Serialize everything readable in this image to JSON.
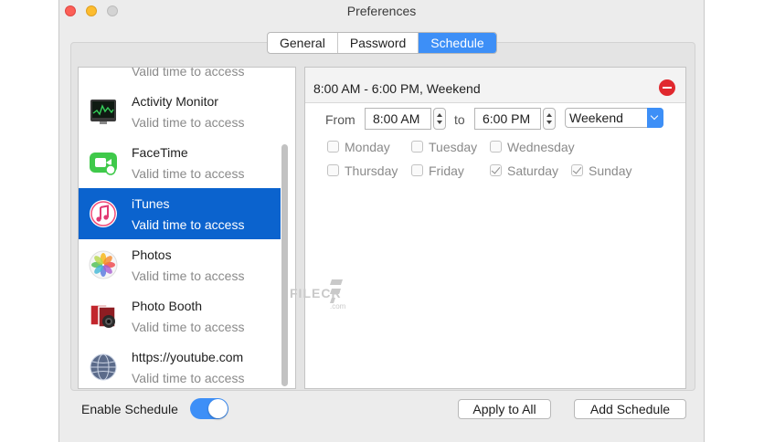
{
  "window": {
    "title": "Preferences"
  },
  "tabs": [
    {
      "label": "General",
      "active": false
    },
    {
      "label": "Password",
      "active": false
    },
    {
      "label": "Schedule",
      "active": true
    }
  ],
  "apps": {
    "partial_top_sub": "Valid time to access",
    "items": [
      {
        "name": "Activity Monitor",
        "subtitle": "Valid time to access",
        "icon": "activity-monitor-icon",
        "selected": false
      },
      {
        "name": "FaceTime",
        "subtitle": "Valid time to access",
        "icon": "facetime-icon",
        "selected": false
      },
      {
        "name": "iTunes",
        "subtitle": "Valid time to access",
        "icon": "itunes-icon",
        "selected": true
      },
      {
        "name": "Photos",
        "subtitle": "Valid time to access",
        "icon": "photos-icon",
        "selected": false
      },
      {
        "name": "Photo Booth",
        "subtitle": "Valid time to access",
        "icon": "photo-booth-icon",
        "selected": false
      },
      {
        "name": "https://youtube.com",
        "subtitle": "Valid time to access",
        "icon": "globe-icon",
        "selected": false
      }
    ]
  },
  "schedule": {
    "header": "8:00 AM - 6:00 PM, Weekend",
    "from_label": "From",
    "from_time": "8:00 AM",
    "to_label": "to",
    "to_time": "6:00 PM",
    "preset": "Weekend",
    "days": [
      {
        "label": "Monday",
        "checked": false
      },
      {
        "label": "Tuesday",
        "checked": false
      },
      {
        "label": "Wednesday",
        "checked": false
      },
      {
        "label": "Thursday",
        "checked": false
      },
      {
        "label": "Friday",
        "checked": false
      },
      {
        "label": "Saturday",
        "checked": true
      },
      {
        "label": "Sunday",
        "checked": true
      }
    ]
  },
  "footer": {
    "enable_label": "Enable Schedule",
    "enabled": true,
    "apply_all": "Apply to All",
    "add_schedule": "Add Schedule"
  },
  "watermark": {
    "text": "FILECR",
    "sub": ".com"
  },
  "colors": {
    "accent": "#3d8ff7",
    "selection": "#0b63ce",
    "remove": "#e0282e"
  }
}
